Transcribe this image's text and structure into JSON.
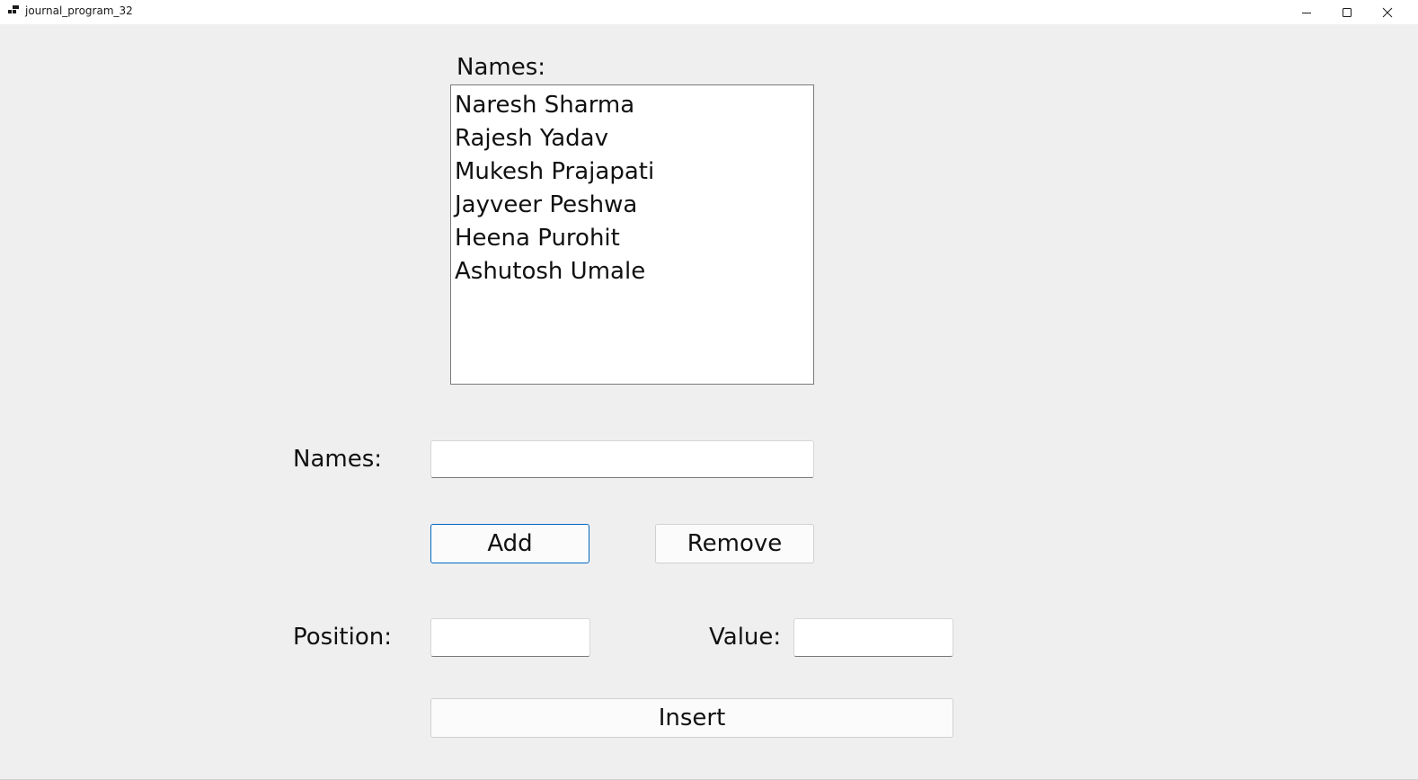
{
  "window": {
    "title": "journal_program_32"
  },
  "list_section": {
    "label": "Names:",
    "items": [
      "Naresh Sharma",
      "Rajesh Yadav",
      "Mukesh Prajapati",
      "Jayveer Peshwa",
      "Heena Purohit",
      "Ashutosh Umale"
    ]
  },
  "name_input": {
    "label": "Names:",
    "value": ""
  },
  "buttons": {
    "add_label": "Add",
    "remove_label": "Remove",
    "insert_label": "Insert"
  },
  "position_input": {
    "label": "Position:",
    "value": ""
  },
  "value_input": {
    "label": "Value:",
    "value": ""
  },
  "icons": {
    "app": "app-icon",
    "minimize": "minimize-icon",
    "maximize": "maximize-icon",
    "close": "close-icon"
  },
  "colors": {
    "background": "#efefef",
    "default_button_border": "#0067c0"
  }
}
